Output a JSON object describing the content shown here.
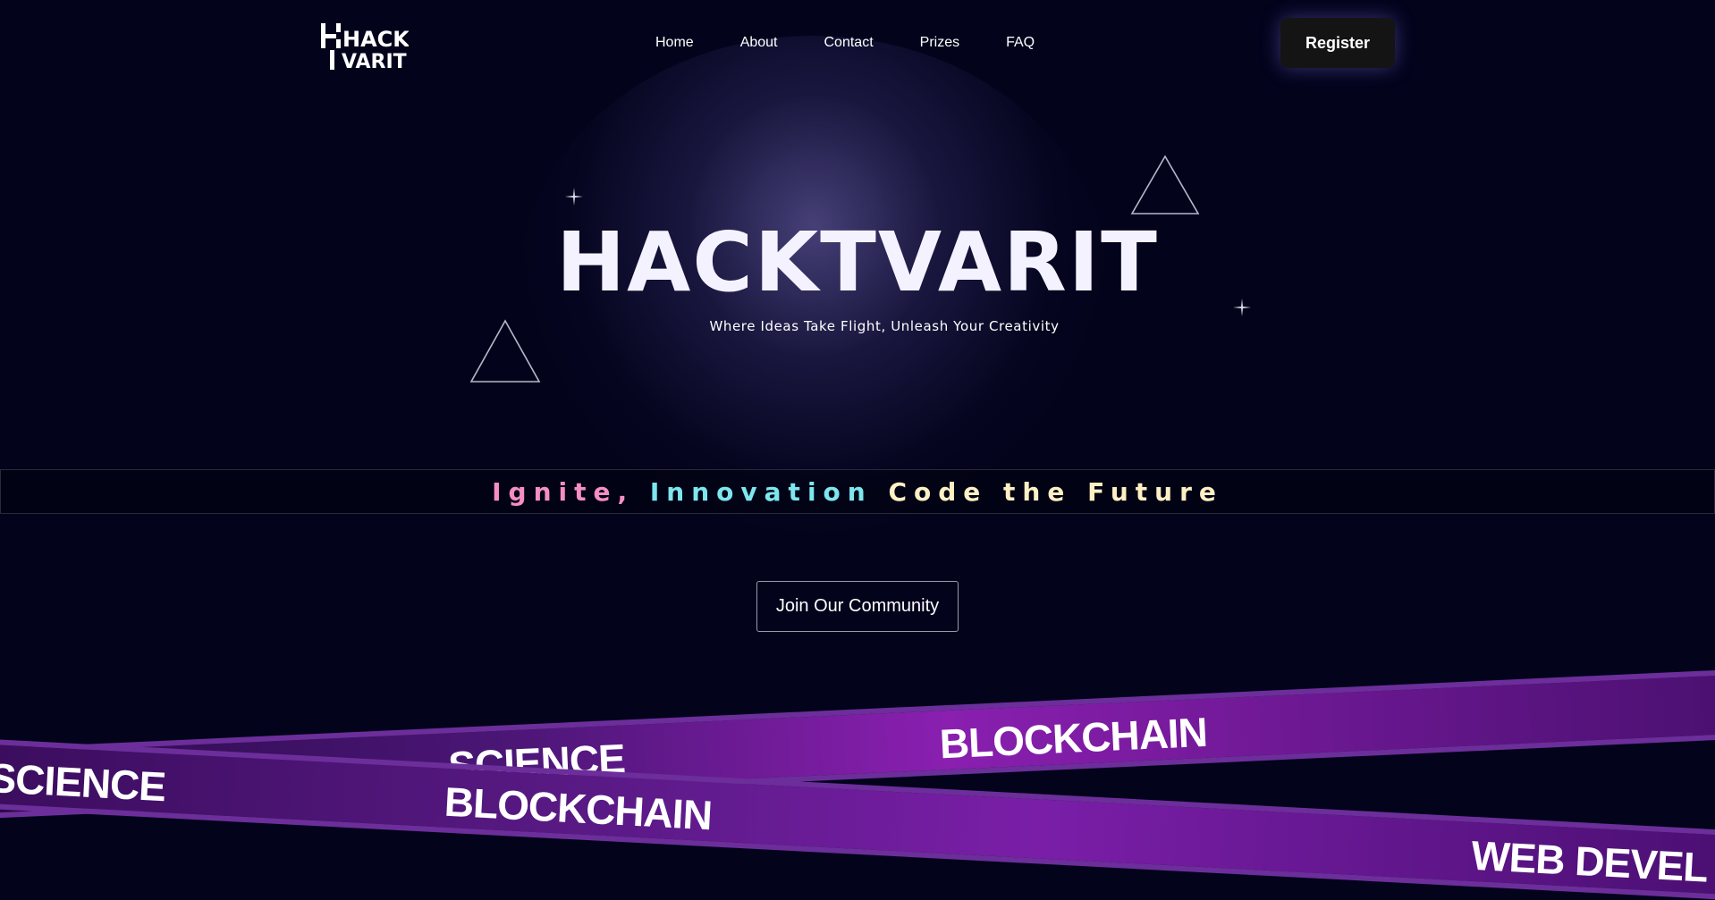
{
  "logo": {
    "line1": "HACK",
    "line2": "VARIT"
  },
  "nav": {
    "links": [
      "Home",
      "About",
      "Contact",
      "Prizes",
      "FAQ"
    ],
    "register_label": "Register"
  },
  "hero": {
    "title": "HACKTVARIT",
    "subtitle": "Where Ideas Take Flight,  Unleash Your Creativity"
  },
  "tagline": {
    "part1": "Ignite,",
    "part2": "Innovation",
    "part3": "Code the Future"
  },
  "community_button": "Join Our Community",
  "ribbons": {
    "front": [
      "SCIENCE",
      "BLOCKCHAIN",
      "WEB DEVEL"
    ],
    "back": [
      "SCIENCE",
      "BLOCKCHAIN"
    ]
  },
  "colors": {
    "background": "#03031c",
    "tag_pink": "#f48fc4",
    "tag_cyan": "#7ee6ee",
    "tag_cream": "#fdf0c4",
    "ribbon_purple": "#7a1ea8"
  }
}
